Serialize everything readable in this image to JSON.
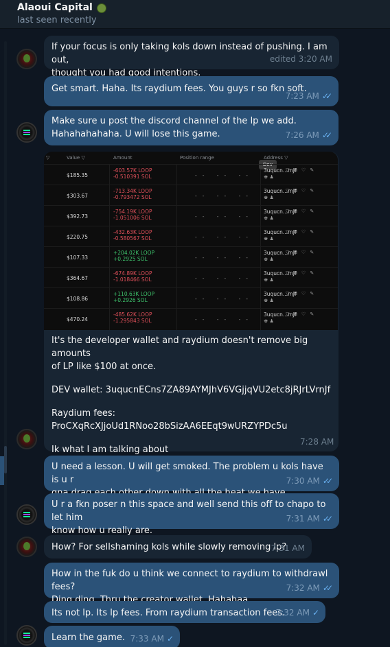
{
  "header": {
    "title": "Alaoui Capital",
    "status": "last seen recently"
  },
  "messages": [
    {
      "line1": "If your focus is only taking kols down instead of pushing. I am out,",
      "line2": "thought you had good intentions.",
      "time": "edited 3:20 AM"
    },
    {
      "line1": "Get smart. Haha. Its raydium fees. You guys r so fkn soft.",
      "time": "7:23 AM"
    },
    {
      "line1": "Make sure u post the discord channel of the lp we add.",
      "line2": "Hahahahahaha. U will lose this game.",
      "time": "7:26 AM"
    },
    {
      "l1": "It's the developer wallet and raydium doesn't remove big amounts",
      "l2": "of LP like $100 at once.",
      "l3": "DEV wallet: 3uqucnECns7ZA89AYMJhV6VGjjqVU2etc8jRJrLVrnJf",
      "l4": "Raydium fees:",
      "l5": "ProCXqRcXJjoUd1RNoo28bSizAA6EEqt9wURZYPDc5u",
      "l6": "Ik what I am talking about",
      "time": "7:28 AM"
    },
    {
      "line1": "U need a lesson.  U will get smoked. The problem u kols have is u r",
      "line2": "gna drag each other down with all the heat we have.",
      "time": "7:30 AM"
    },
    {
      "line1": "U r a fkn poser n this space and well send this off to chapo to let him",
      "line2": "know how u really are.",
      "time": "7:31 AM"
    },
    {
      "line1": "How? For sellshaming kols while slowly removing lp?",
      "time": "7:31 AM"
    },
    {
      "line1": "How in the fuk do u think we connect to raydium to withdrawl fees?",
      "line2": "Ding ding. Thru the creator wallet. Hahahaa",
      "time": "7:32 AM"
    },
    {
      "line1": "Its not lp. Its lp fees. From raydium transaction fees.",
      "time": "7:32 AM"
    },
    {
      "line1": "Learn the game.",
      "time": "7:33 AM"
    }
  ],
  "screenshot_table": {
    "headers": {
      "value": "Value ▽",
      "amount": "Amount",
      "range": "Position range",
      "address": "Address ▽"
    },
    "tooltip": "Dev",
    "rows": [
      {
        "value": "$185.35",
        "loop": "-603.57K LOOP",
        "sol": "-0.510391 SOL",
        "addr": "3uqucn...rnJf",
        "sign": "neg"
      },
      {
        "value": "$303.67",
        "loop": "-713.34K LOOP",
        "sol": "-0.793472 SOL",
        "addr": "3uqucn...rnJf",
        "sign": "neg"
      },
      {
        "value": "$392.73",
        "loop": "-754.19K LOOP",
        "sol": "-1.051006 SOL",
        "addr": "3uqucn...rnJf",
        "sign": "neg"
      },
      {
        "value": "$220.75",
        "loop": "-432.63K LOOP",
        "sol": "-0.580567 SOL",
        "addr": "3uqucn...rnJf",
        "sign": "neg"
      },
      {
        "value": "$107.33",
        "loop": "+204.02K LOOP",
        "sol": "+0.2925 SOL",
        "addr": "3uqucn...rnJf",
        "sign": "pos"
      },
      {
        "value": "$364.67",
        "loop": "-674.89K LOOP",
        "sol": "-1.018466 SOL",
        "addr": "3uqucn...rnJf",
        "sign": "neg"
      },
      {
        "value": "$108.86",
        "loop": "+110.63K LOOP",
        "sol": "+0.2926 SOL",
        "addr": "3uqucn...rnJf",
        "sign": "pos"
      },
      {
        "value": "$470.24",
        "loop": "-485.62K LOOP",
        "sol": "-1.295843 SOL",
        "addr": "3uqucn...rnJf",
        "sign": "neg"
      }
    ],
    "range_placeholder": "-- -- --"
  },
  "colors": {
    "bg": "#0e1621",
    "incoming": "#182533",
    "outgoing": "#2b5278",
    "check": "#6ab2f2"
  }
}
